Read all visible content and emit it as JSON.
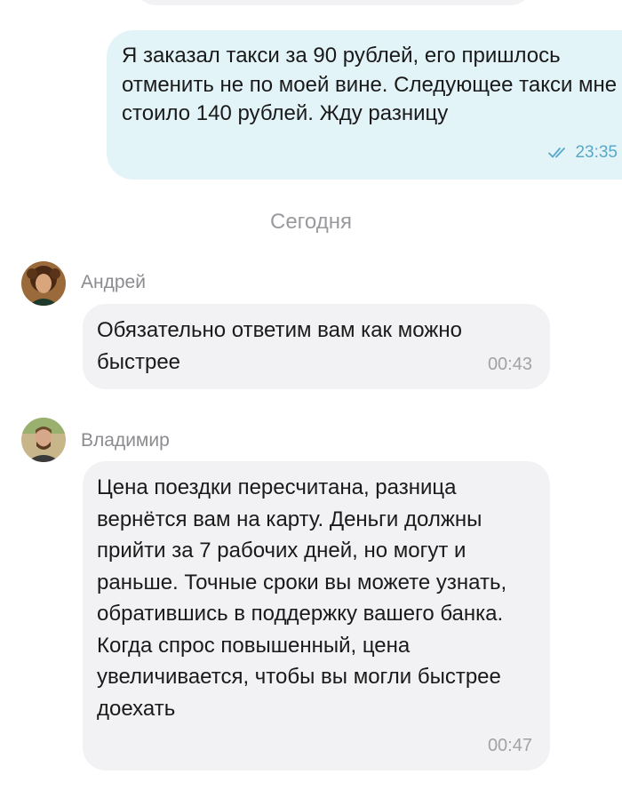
{
  "messages": {
    "outgoing": {
      "text": "Я заказал такси за 90 рублей, его пришлось отменить не по моей вине. Следующее такси мне стоило 140 рублей. Жду разницу",
      "time": "23:35",
      "status_icon": "double-check-icon"
    },
    "date_separator": "Сегодня",
    "incoming": [
      {
        "sender": "Андрей",
        "text": "Обязательно ответим вам как можно быстрее",
        "time": "00:43"
      },
      {
        "sender": "Владимир",
        "text": "Цена поездки пересчитана, разница вернётся вам на карту. Деньги должны прийти за 7 рабочих дней, но могут и раньше. Точные сроки вы можете узнать, обратившись в поддержку вашего банка. Когда спрос повышенный, цена увеличивается, чтобы вы могли быстрее доехать",
        "time": "00:47"
      }
    ]
  },
  "colors": {
    "outgoing_bubble": "#e3f4f9",
    "incoming_bubble": "#f2f2f4",
    "read_check": "#58a8c8",
    "secondary_text": "#9a9a9e"
  }
}
